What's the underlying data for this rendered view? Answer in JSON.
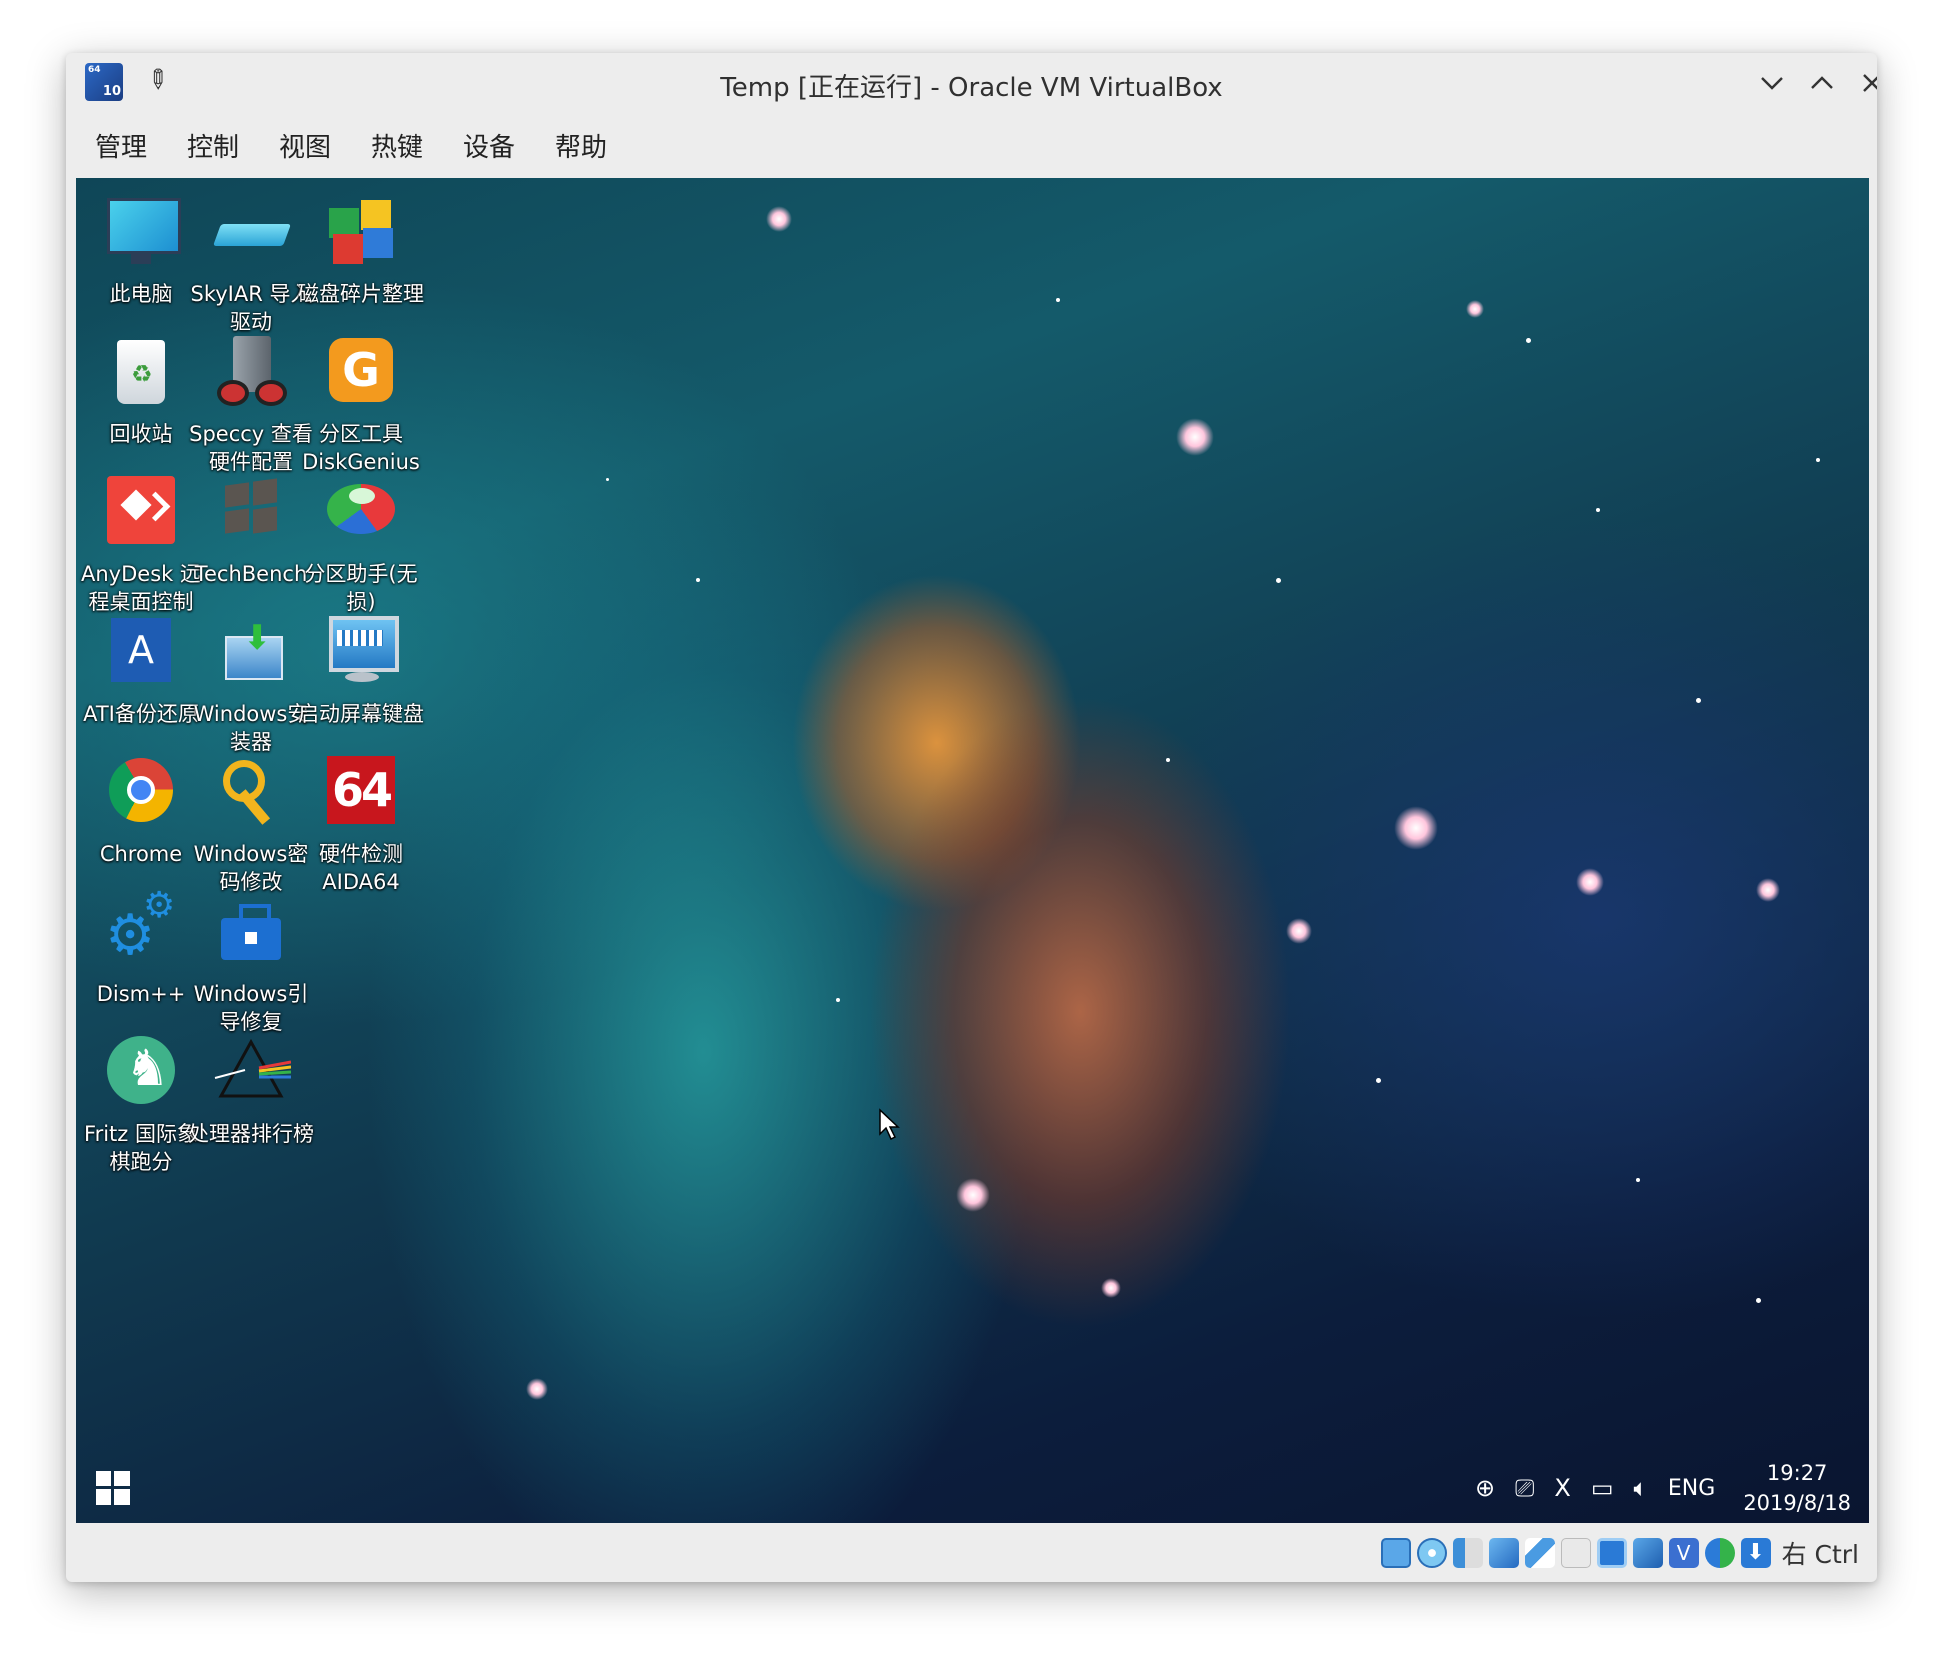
{
  "window": {
    "title": "Temp [正在运行] - Oracle VM VirtualBox",
    "app_icon_badge_top": "64",
    "app_icon_badge_bottom": "10"
  },
  "menu": [
    "管理",
    "控制",
    "视图",
    "热键",
    "设备",
    "帮助"
  ],
  "desktop_icons": [
    {
      "label": "此电脑",
      "icon": "computer-icon"
    },
    {
      "label": "SkyIAR 导入\n驱动",
      "icon": "drive-import-icon"
    },
    {
      "label": "磁盘碎片整理",
      "icon": "disk-defrag-icon"
    },
    {
      "label": "回收站",
      "icon": "recycle-bin-icon"
    },
    {
      "label": "Speccy 查看\n硬件配置",
      "icon": "speccy-icon"
    },
    {
      "label": "分区工具\nDiskGenius",
      "icon": "diskgenius-icon"
    },
    {
      "label": "AnyDesk 远\n程桌面控制",
      "icon": "anydesk-icon"
    },
    {
      "label": "TechBench",
      "icon": "techbench-icon"
    },
    {
      "label": "分区助手(无\n损)",
      "icon": "partition-assistant-icon"
    },
    {
      "label": "ATI备份还原",
      "icon": "ati-backup-icon"
    },
    {
      "label": "Windows安\n装器",
      "icon": "windows-installer-icon"
    },
    {
      "label": "启动屏幕键盘",
      "icon": "onscreen-keyboard-icon"
    },
    {
      "label": "Chrome",
      "icon": "chrome-icon"
    },
    {
      "label": "Windows密\n码修改",
      "icon": "password-key-icon"
    },
    {
      "label": "硬件检测\nAIDA64",
      "icon": "aida64-icon"
    },
    {
      "label": "Dism++",
      "icon": "dism-gear-icon"
    },
    {
      "label": "Windows引\n导修复",
      "icon": "boot-repair-toolbox-icon"
    },
    {
      "label": "Fritz 国际象\n棋跑分",
      "icon": "fritz-chess-icon"
    },
    {
      "label": "处理器排行榜",
      "icon": "prism-icon"
    }
  ],
  "taskbar": {
    "tray_icons": [
      "network-globe-icon",
      "display-icon",
      "x-icon",
      "battery-icon",
      "volume-icon"
    ],
    "language": "ENG",
    "time": "19:27",
    "date": "2019/8/18"
  },
  "statusbar": {
    "icons": [
      "hard-disk-icon",
      "optical-disk-icon",
      "audio-icon",
      "network-icon",
      "usb-icon",
      "shared-folder-icon",
      "display-status-icon",
      "video-capture-icon",
      "virtualization-icon",
      "guest-additions-icon",
      "download-arrow-icon"
    ],
    "host_key": "右 Ctrl"
  },
  "colors": {
    "window_bg": "#ededed",
    "anydesk_red": "#ef443b",
    "aida_red": "#c8161d",
    "diskgenius_orange": "#f39a1e"
  }
}
